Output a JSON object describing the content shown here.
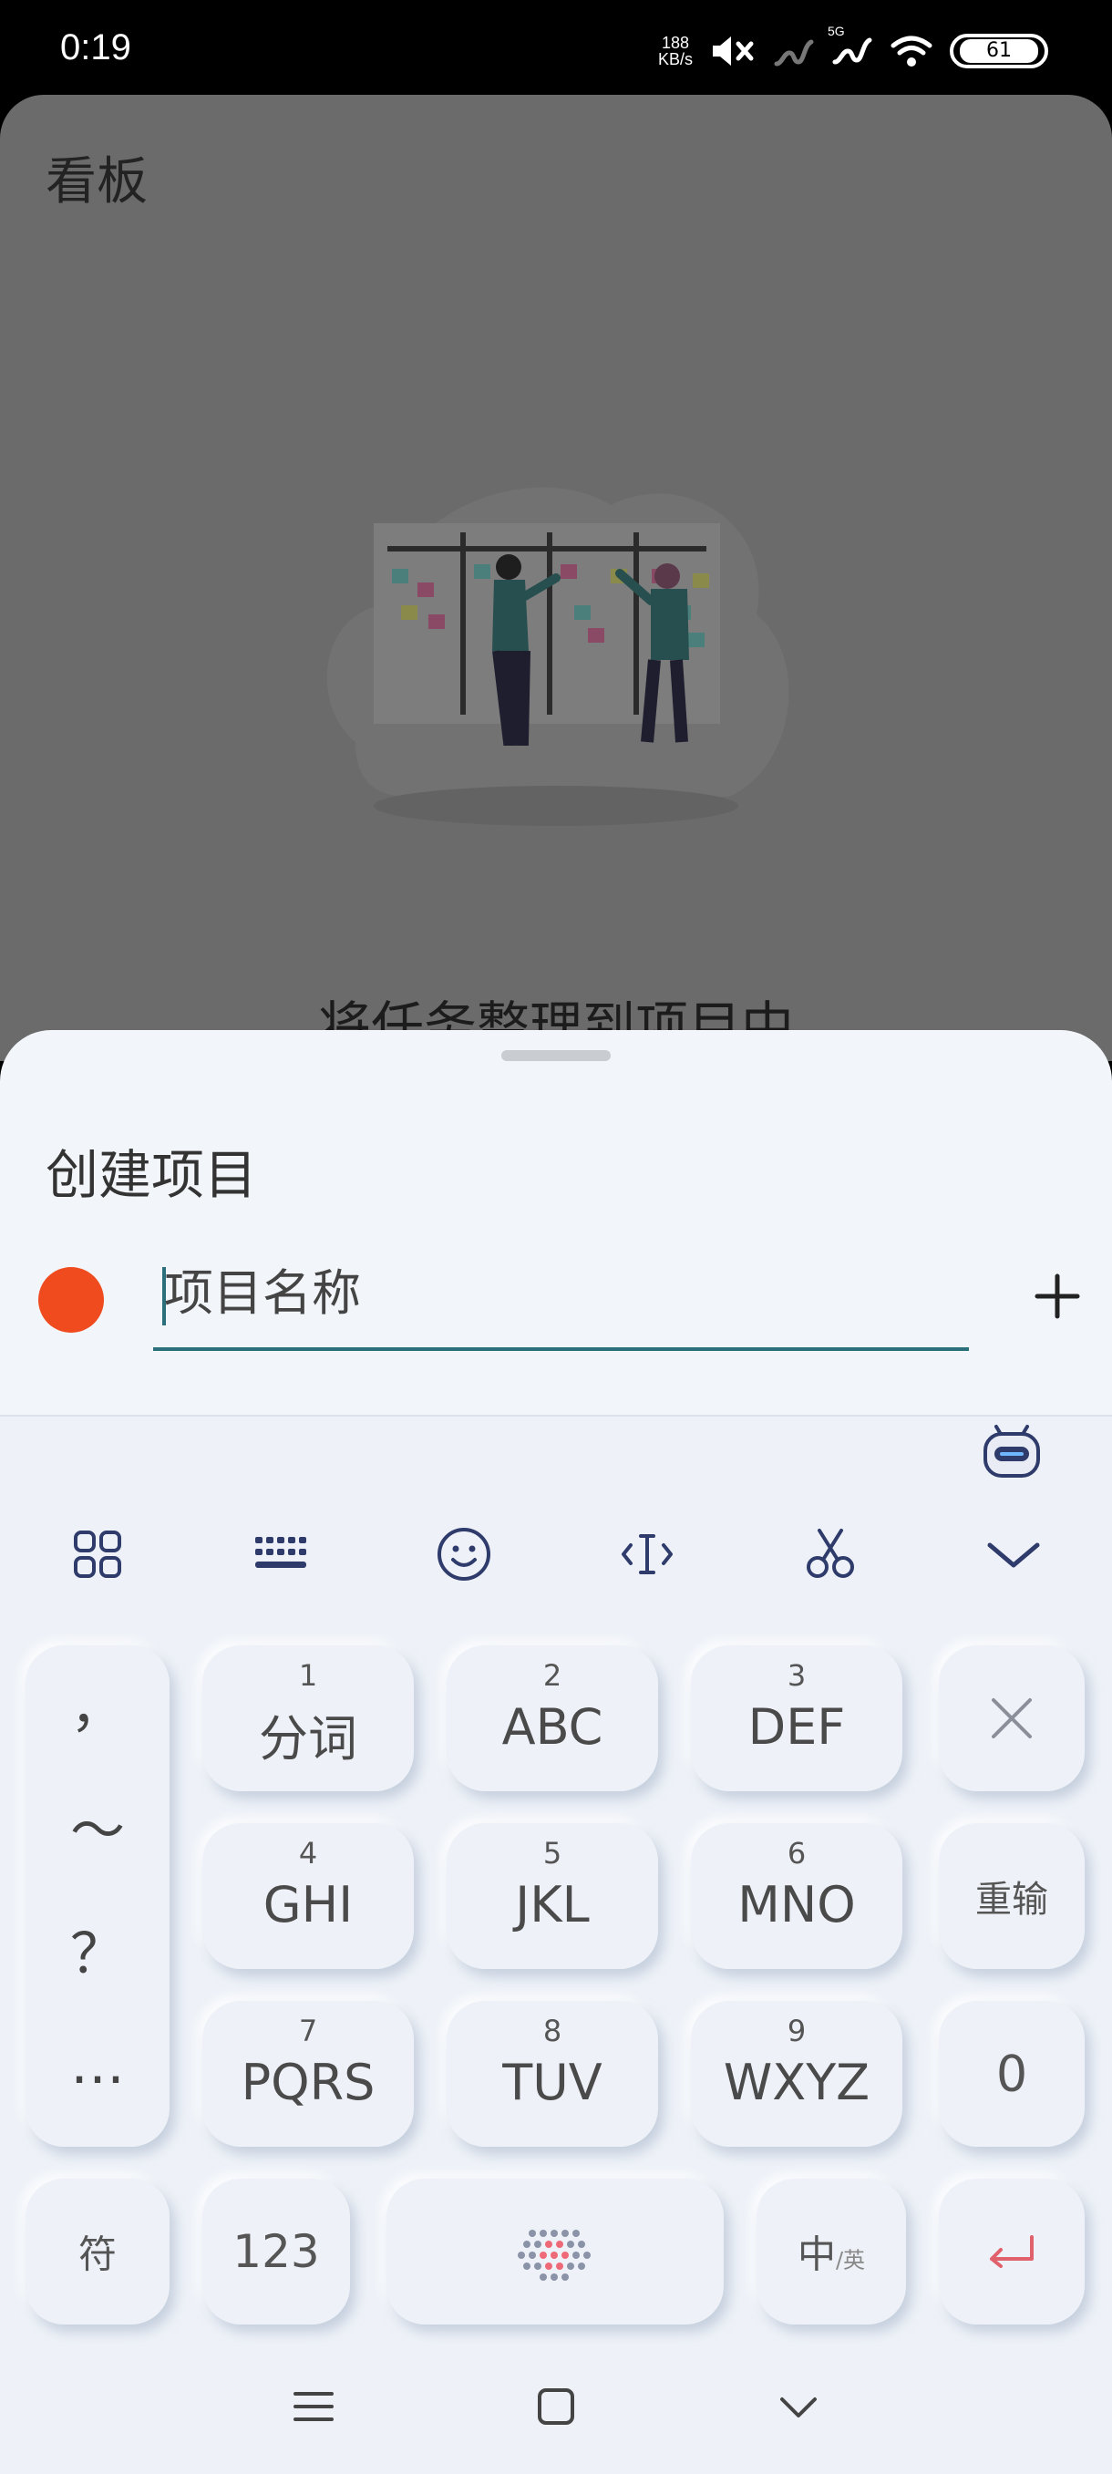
{
  "status_bar": {
    "time": "0:19",
    "speed_value": "188",
    "speed_unit": "KB/s",
    "network": "5G",
    "battery": "61"
  },
  "app": {
    "title": "看板",
    "heading": "将任务整理到项目中"
  },
  "sheet": {
    "title": "创建项目",
    "name_placeholder": "项目名称",
    "color": "#f04a1f",
    "add_icon": "plus-icon"
  },
  "keyboard": {
    "toolbar": [
      "apps-icon",
      "keyboard-icon",
      "emoji-icon",
      "cursor-icon",
      "scissors-icon",
      "collapse-icon"
    ],
    "punctuation": [
      "，",
      "～",
      "？",
      "…"
    ],
    "keys": [
      {
        "num": "1",
        "label": "分词"
      },
      {
        "num": "2",
        "label": "ABC"
      },
      {
        "num": "3",
        "label": "DEF"
      },
      {
        "num": "4",
        "label": "GHI"
      },
      {
        "num": "5",
        "label": "JKL"
      },
      {
        "num": "6",
        "label": "MNO"
      },
      {
        "num": "7",
        "label": "PQRS"
      },
      {
        "num": "8",
        "label": "TUV"
      },
      {
        "num": "9",
        "label": "WXYZ"
      }
    ],
    "reinput": "重输",
    "zero": "0",
    "symbols": "符",
    "numbers": "123",
    "lang_main": "中",
    "lang_sub": "/英"
  },
  "nav": [
    "menu-icon",
    "home-icon",
    "back-icon"
  ]
}
